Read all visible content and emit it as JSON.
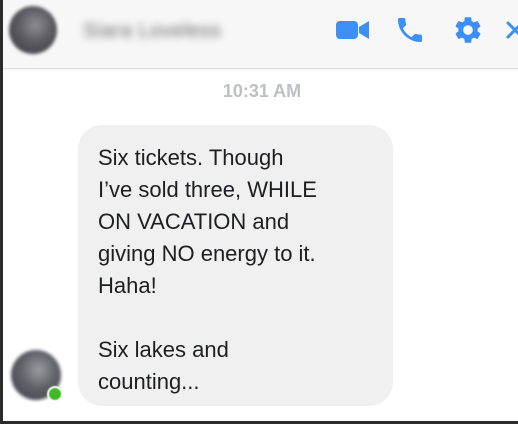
{
  "header": {
    "contact_name": "Siara Loveless",
    "icons": [
      "video-call-icon",
      "phone-call-icon",
      "settings-gear-icon",
      "close-icon"
    ],
    "accent_color": "#3b8ff7"
  },
  "conversation": {
    "timestamp": "10:31 AM",
    "messages": [
      {
        "sender": "contact",
        "text": "Six tickets. Though\nI’ve sold three, WHILE\nON VACATION and\ngiving NO energy to it.\nHaha!\n\nSix lakes and\ncounting..."
      }
    ]
  },
  "colors": {
    "bubble_background": "#f1f0f0",
    "timestamp_text": "#bcc0c4",
    "presence_online": "#42b72a"
  }
}
